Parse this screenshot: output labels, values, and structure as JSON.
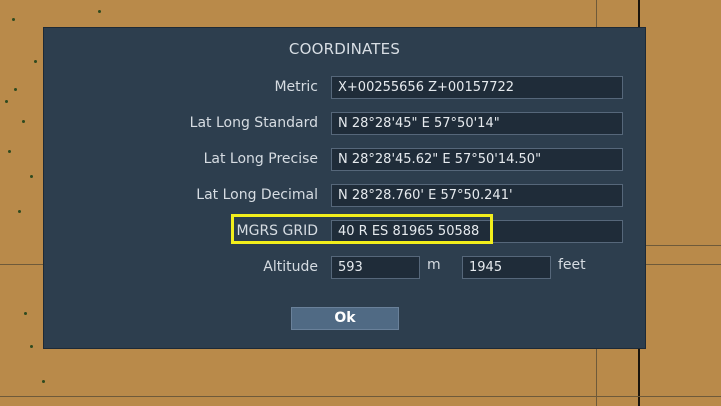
{
  "dialog": {
    "title": "COORDINATES",
    "rows": [
      {
        "label": "Metric",
        "value": "X+00255656 Z+00157722"
      },
      {
        "label": "Lat Long Standard",
        "value": "N 28°28'45\"   E 57°50'14\""
      },
      {
        "label": "Lat Long Precise",
        "value": "N 28°28'45.62\"   E 57°50'14.50\""
      },
      {
        "label": "Lat Long Decimal",
        "value": "N 28°28.760'   E 57°50.241'"
      },
      {
        "label": "MGRS GRID",
        "value": "40 R ES 81965 50588"
      }
    ],
    "altitude": {
      "label": "Altitude",
      "meters": "593",
      "meters_unit": "m",
      "feet": "1945",
      "feet_unit": "feet"
    },
    "ok_label": "Ok"
  },
  "colors": {
    "dialog_bg": "#2d3e4e",
    "field_bg": "#1f2c39",
    "highlight": "#f2ee1c",
    "map_bg": "#b98a4a"
  }
}
